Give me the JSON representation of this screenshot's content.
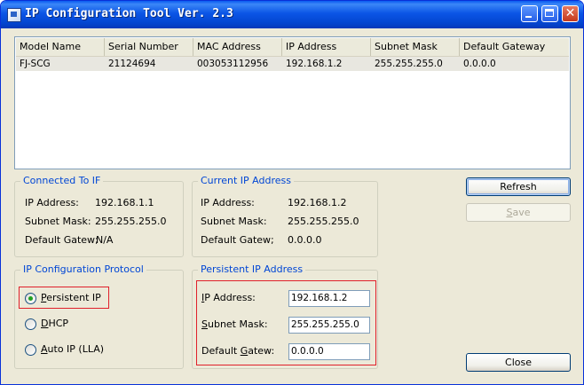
{
  "window": {
    "title": "IP Configuration Tool  Ver. 2.3"
  },
  "device_list": {
    "columns": [
      "Model Name",
      "Serial Number",
      "MAC Address",
      "IP Address",
      "Subnet Mask",
      "Default Gateway"
    ],
    "rows": [
      [
        "FJ-SCG",
        "21124694",
        "003053112956",
        "192.168.1.2",
        "255.255.255.0",
        "0.0.0.0"
      ]
    ]
  },
  "connected_to_if": {
    "title": "Connected To IF",
    "ip_label": "IP Address:",
    "ip_value": "192.168.1.1",
    "mask_label": "Subnet Mask:",
    "mask_value": "255.255.255.0",
    "gw_label": "Default Gatew;",
    "gw_value": "N/A"
  },
  "current_ip": {
    "title": "Current IP Address",
    "ip_label": "IP Address:",
    "ip_value": "192.168.1.2",
    "mask_label": "Subnet Mask:",
    "mask_value": "255.255.255.0",
    "gw_label": "Default Gatew;",
    "gw_value": "0.0.0.0"
  },
  "protocol": {
    "title": "IP Configuration Protocol",
    "persistent_mnemonic": "P",
    "persistent_rest": "ersistent IP",
    "dhcp_mnemonic": "D",
    "dhcp_rest": "HCP",
    "autoip_mnemonic": "A",
    "autoip_rest": "uto IP (LLA)",
    "selected": "Persistent IP"
  },
  "persistent_ip": {
    "title": "Persistent IP Address",
    "ip_mnemonic": "I",
    "ip_rest": "P Address:",
    "ip_value": "192.168.1.2",
    "mask_mnemonic": "S",
    "mask_rest": "ubnet Mask:",
    "mask_value": "255.255.255.0",
    "gw_prefix": "Default ",
    "gw_mnemonic": "G",
    "gw_rest": "atew:",
    "gw_value": "0.0.0.0"
  },
  "buttons": {
    "refresh": "Refresh",
    "save_mnemonic": "S",
    "save_rest": "ave",
    "close": "Close"
  },
  "colors": {
    "highlight_box": "#e0202a",
    "group_title": "#0046d5"
  }
}
